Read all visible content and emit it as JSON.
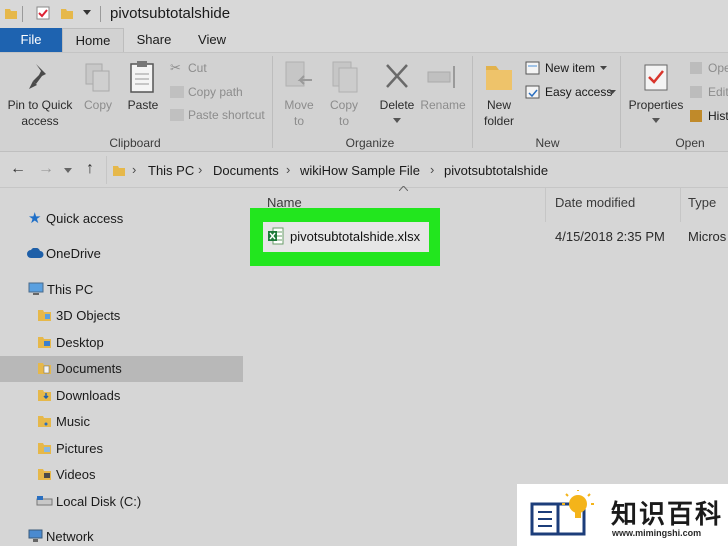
{
  "window": {
    "title": "pivotsubtotalshide"
  },
  "tabs": {
    "file": "File",
    "home": "Home",
    "share": "Share",
    "view": "View"
  },
  "ribbon": {
    "clipboard": {
      "group_label": "Clipboard",
      "pin_line1": "Pin to Quick",
      "pin_line2": "access",
      "copy": "Copy",
      "paste": "Paste",
      "cut": "Cut",
      "copy_path": "Copy path",
      "paste_shortcut": "Paste shortcut"
    },
    "organize": {
      "group_label": "Organize",
      "move_line1": "Move",
      "move_line2": "to",
      "copy_line1": "Copy",
      "copy_line2": "to",
      "delete": "Delete",
      "rename": "Rename"
    },
    "new": {
      "group_label": "New",
      "folder_line1": "New",
      "folder_line2": "folder",
      "new_item": "New item",
      "easy_access": "Easy access"
    },
    "open": {
      "group_label": "Open",
      "properties": "Properties",
      "open_item": "Ope",
      "edit_item": "Edit",
      "history_item": "Hist"
    }
  },
  "address": {
    "crumbs": [
      "This PC",
      "Documents",
      "wikiHow Sample File",
      "pivotsubtotalshide"
    ]
  },
  "nav": {
    "quick_access": "Quick access",
    "onedrive": "OneDrive",
    "this_pc": "This PC",
    "objects3d": "3D Objects",
    "desktop": "Desktop",
    "documents": "Documents",
    "downloads": "Downloads",
    "music": "Music",
    "pictures": "Pictures",
    "videos": "Videos",
    "local_disk": "Local Disk (C:)",
    "network": "Network"
  },
  "columns": {
    "name": "Name",
    "date_modified": "Date modified",
    "type": "Type"
  },
  "files": [
    {
      "name": "pivotsubtotalshide.xlsx",
      "date": "4/15/2018 2:35 PM",
      "type": "Micros"
    }
  ],
  "watermark": {
    "cn": "知识百科",
    "url": "www.mimingshi.com"
  },
  "colors": {
    "file_tab": "#1e63b0",
    "highlight": "#22e61e",
    "selected_nav": "#b8b8b8"
  }
}
